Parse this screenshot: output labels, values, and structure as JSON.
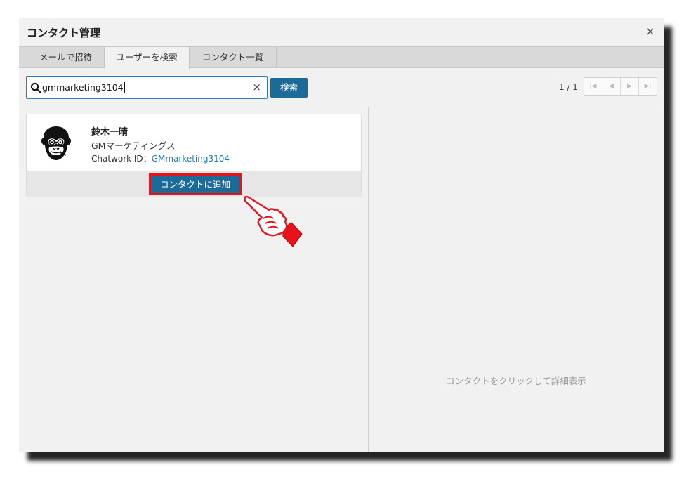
{
  "dialog": {
    "title": "コンタクト管理",
    "close_symbol": "×"
  },
  "tabs": [
    {
      "label": "メールで招待"
    },
    {
      "label": "ユーザーを検索",
      "active": true
    },
    {
      "label": "コンタクト一覧"
    }
  ],
  "search": {
    "value": "gmmarketing3104",
    "clear_symbol": "×",
    "button_label": "検索",
    "icon": "search-icon"
  },
  "pagination": {
    "page_info": "1 / 1",
    "first": "|◀",
    "prev": "◀",
    "next": "▶",
    "last": "▶|"
  },
  "result": {
    "name": "鈴木一晴",
    "company": "GMマーケティングス",
    "id_label": "Chatwork ID：",
    "id_value": "GMmarketing3104",
    "add_button_label": "コンタクトに追加"
  },
  "detail": {
    "placeholder": "コンタクトをクリックして詳細表示"
  },
  "colors": {
    "primary": "#1b6a97",
    "link": "#1b78b0",
    "highlight": "#e8131a"
  }
}
